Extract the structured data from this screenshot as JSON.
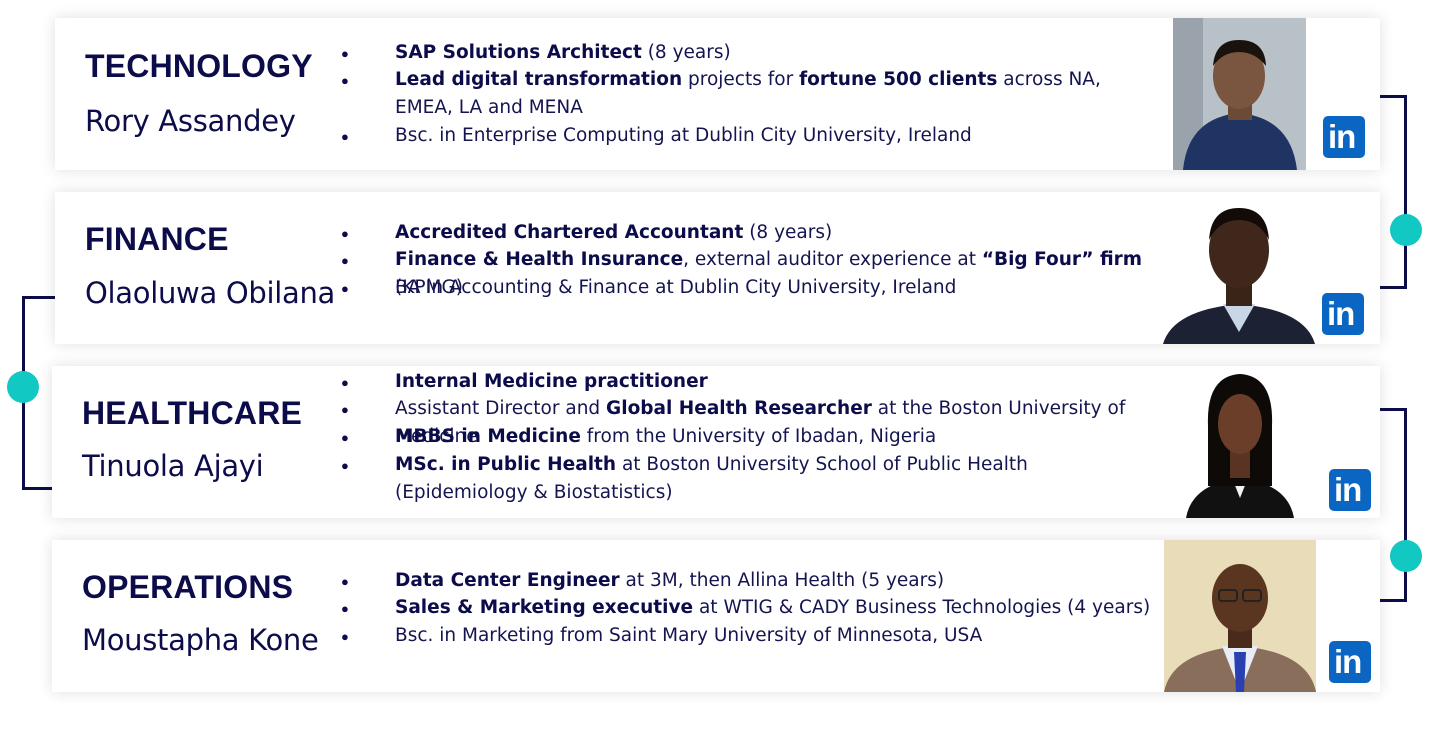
{
  "members": [
    {
      "category": "TECHNOLOGY",
      "name": "Rory Assandey",
      "bullets": [
        [
          {
            "t": "SAP Solutions Architect",
            "b": true
          },
          {
            "t": " (8 years)",
            "b": false
          }
        ],
        [
          {
            "t": "Lead digital transformation",
            "b": true
          },
          {
            "t": " projects for ",
            "b": false
          },
          {
            "t": "fortune 500 clients",
            "b": true
          },
          {
            "t": " across NA, EMEA, LA and MENA",
            "b": false
          }
        ],
        [
          {
            "t": "Bsc. in Enterprise Computing at Dublin City University, Ireland",
            "b": false
          }
        ]
      ],
      "linkedin": "in"
    },
    {
      "category": "FINANCE",
      "name": "Olaoluwa Obilana",
      "bullets": [
        [
          {
            "t": "Accredited Chartered Accountant",
            "b": true
          },
          {
            "t": "  (8 years)",
            "b": false
          }
        ],
        [
          {
            "t": "Finance & Health Insurance",
            "b": true
          },
          {
            "t": ", external auditor experience at ",
            "b": false
          },
          {
            "t": "“Big Four” firm",
            "b": true
          },
          {
            "t": " (KPMG)",
            "b": false
          }
        ],
        [
          {
            "t": "BA in Accounting & Finance at Dublin City University, Ireland",
            "b": false
          }
        ]
      ],
      "linkedin": "in"
    },
    {
      "category": "HEALTHCARE",
      "name": "Tinuola Ajayi",
      "bullets": [
        [
          {
            "t": "Internal Medicine practitioner",
            "b": true
          }
        ],
        [
          {
            "t": "Assistant Director and ",
            "b": false
          },
          {
            "t": "Global Health Researcher",
            "b": true
          },
          {
            "t": " at the Boston University of Medicine",
            "b": false
          }
        ],
        [
          {
            "t": "MBBS in Medicine",
            "b": true
          },
          {
            "t": " from the University of Ibadan, Nigeria",
            "b": false
          }
        ],
        [
          {
            "t": "MSc. in Public Health",
            "b": true
          },
          {
            "t": " at Boston University School of Public Health (Epidemiology & Biostatistics)",
            "b": false
          }
        ]
      ],
      "linkedin": "in"
    },
    {
      "category": "OPERATIONS",
      "name": "Moustapha Kone",
      "bullets": [
        [
          {
            "t": "Data Center Engineer",
            "b": true
          },
          {
            "t": " at 3M, then Allina Health (5 years)",
            "b": false
          }
        ],
        [
          {
            "t": "Sales & Marketing executive",
            "b": true
          },
          {
            "t": " at WTIG & CADY Business Technologies (4 years)",
            "b": false
          }
        ],
        [
          {
            "t": "Bsc. in Marketing from Saint Mary University of Minnesota, USA",
            "b": false
          }
        ]
      ],
      "linkedin": "in"
    }
  ],
  "colors": {
    "navy": "#0c0c4a",
    "teal": "#12c8c2",
    "linkedin": "#0a66c2"
  }
}
